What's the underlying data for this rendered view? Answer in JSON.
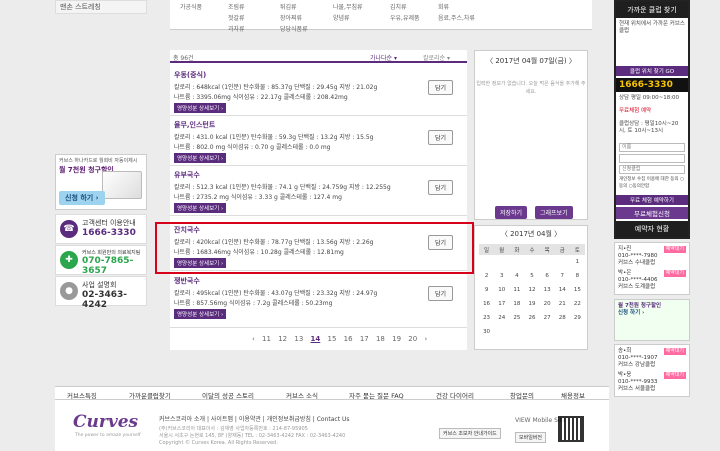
{
  "left": {
    "top_label": "맨손 스트레칭",
    "promo": {
      "line1": "커브스 하나카드로 월회비 자동이체시",
      "line2": "월 7천원 청구할인",
      "signup": "신청 하기 ›"
    },
    "contacts": [
      {
        "label": "고객센터 이용안내",
        "number": "1666-3330",
        "note": "",
        "icon": "headset-icon",
        "color": "#5b2c7e"
      },
      {
        "label": "커브스 회원만의 의료복지팀",
        "number": "070-7865-3657",
        "note": "",
        "icon": "ambulance-icon",
        "color": "#2aa64c"
      },
      {
        "label": "사업 설명회",
        "number": "02-3463-4242",
        "note": "",
        "icon": "person-icon",
        "color": "#888888"
      }
    ]
  },
  "top_strip": [
    "가공식품",
    "조림류",
    "튀김류",
    "나물,무침류",
    "김치류",
    "회류",
    "젓갈류",
    "장아찌류",
    "양념류",
    "우유,유제품",
    "음료,주스,차류",
    "과자류",
    "당당식품류"
  ],
  "list": {
    "count": "총 96건",
    "sort_active": "가나다순 ▾",
    "sort_other": "칼로리순 ▾",
    "info_label": "영양성분 상세보기 ›",
    "add_label": "담기",
    "items": [
      {
        "name": "우동(중식)",
        "r1": "칼로리 : 648kcal (1인분)   탄수화물 : 85.37g   단백질 : 29.45g   지방 : 21.02g",
        "r2": "나트륨 : 3395.06mg   식이섬유 : 22.17g   콜레스테롤 : 208.42mg"
      },
      {
        "name": "율무,인스턴트",
        "r1": "칼로리 : 431.0 kcal (1인분)   탄수화물 : 59.3g   단백질 : 13.2g   지방 : 15.5g",
        "r2": "나트륨 : 802.0 mg   식이섬유 : 0.70 g   콜레스테롤 : 0.0 mg"
      },
      {
        "name": "유부국수",
        "r1": "칼로리 : 512.3 kcal (1인분)   탄수화물 : 74.1 g   단백질 : 24.759g   지방 : 12.255g",
        "r2": "나트륨 : 2735.2 mg   식이섬유 : 3.33 g   콜레스테롤 : 127.4 mg"
      },
      {
        "name": "잔치국수",
        "r1": "칼로리 : 420kcal (1인분)   탄수화물 : 78.77g   단백질 : 13.56g   지방 : 2.26g",
        "r2": "나트륨 : 1683.46mg   식이섬유 : 10.28g   콜레스테롤 : 12.81mg"
      },
      {
        "name": "쟁반국수",
        "r1": "칼로리 : 495kcal (1인분)   탄수화물 : 43.07g   단백질 : 23.32g   지방 : 24.97g",
        "r2": "나트륨 : 857.56mg   식이섬유 : 7.2g   콜레스테롤 : 50.23mg"
      }
    ],
    "pages": [
      "‹",
      "11",
      "12",
      "13",
      "14",
      "15",
      "16",
      "17",
      "18",
      "19",
      "20",
      "›"
    ],
    "current_page": "14"
  },
  "memo": {
    "date": "〈  2017년 04월 07일(금)  〉",
    "hint": "입력한 정보가 없습니다. 오늘 먹은 음식을 추가해 주세요.",
    "save": "저장하기",
    "graph": "그래프보기"
  },
  "calendar": {
    "header": "〈  2017년 04월  〉",
    "weekdays": [
      "일",
      "월",
      "화",
      "수",
      "목",
      "금",
      "토"
    ],
    "weeks": [
      [
        "",
        "",
        "",
        "",
        "",
        "",
        "1"
      ],
      [
        "2",
        "3",
        "4",
        "5",
        "6",
        "7",
        "8"
      ],
      [
        "9",
        "10",
        "11",
        "12",
        "13",
        "14",
        "15"
      ],
      [
        "16",
        "17",
        "18",
        "19",
        "20",
        "21",
        "22"
      ],
      [
        "23",
        "24",
        "25",
        "26",
        "27",
        "28",
        "29"
      ],
      [
        "30",
        "",
        "",
        "",
        "",
        "",
        ""
      ]
    ]
  },
  "far_right": {
    "find_club": "가까운 클럽 찾기",
    "current": "현재 위치에서 가까운 커브스 클럽",
    "find_btn": "클럽 위치 찾기 GO",
    "phone": "1666-3330",
    "phone_note": "상담 평일 09:00~18:00",
    "reserve_title": "무료체험 예약",
    "reserve_lines": [
      "무료 체험 예약하기",
      "클럽상담 : 평일10시~20시, 토 10시~13시"
    ],
    "name_ph": "이름",
    "club_ph": "신청클럽",
    "agree": "개인정보 수집 이용에 대한 동의 ○동의 ○동의안함",
    "free_btn": "무료체험신청",
    "status_title": "예약자 현황",
    "status": [
      {
        "who": "지•진",
        "phone": "010-****-7980",
        "club": "커브스 수내클럽",
        "badge": "예약대기"
      },
      {
        "who": "박•은",
        "phone": "010-****-4406",
        "club": "커브스 도계클럽",
        "badge": "예약대기"
      },
      {
        "who": "송•희",
        "phone": "010-****-1907",
        "club": "커브스 강남클럽",
        "badge": "예약대기"
      },
      {
        "who": "박•응",
        "phone": "010-****-9933",
        "club": "커브스 서울클럽",
        "badge": "예약대기"
      }
    ]
  },
  "nav": [
    "커브스특징",
    "가까운클럽찾기",
    "이달의 성공 스토리",
    "커브스 소식",
    "자주 묻는 질문 FAQ",
    "건강 다이어리",
    "창업문의",
    "채용정보"
  ],
  "footer": {
    "logo": "Curves",
    "tagline": "The power to amaze yourself",
    "links": "커브스코리아 소개  |  사이트맵  |  이용약관  |  개인정보취급방침  |  Contact Us",
    "addr1": "(주)커브스코리아   대표이사 : 김재영   사업자등록번호 : 214-87-95905",
    "addr2": "서울시 서초구 논현로 145, 8F (양재동)   TEL : 02-3463-4242   FAX : 02-3463-4240",
    "copy": "Copyright © Curves Korea. All Rights Reserved.",
    "pbtn": "커브스 조보자 안내가이드",
    "view": "VIEW Mobile Site",
    "mobile": "모바일버전"
  }
}
